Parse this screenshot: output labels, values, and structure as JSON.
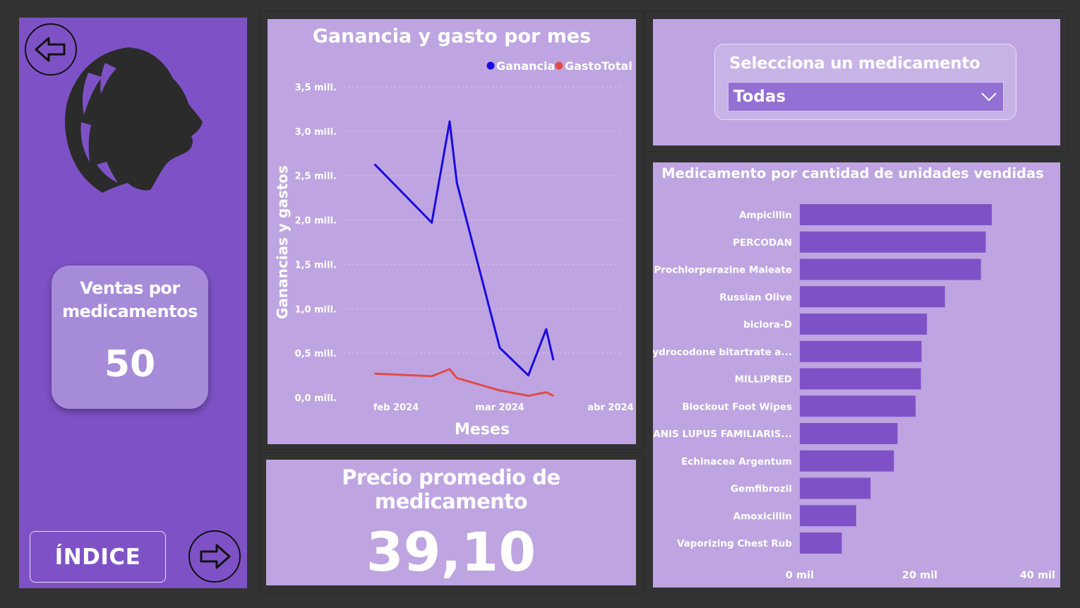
{
  "sidebar": {
    "kpi_label": "Ventas por medicamentos",
    "kpi_value": "50",
    "index_label": "ÍNDICE",
    "icons": {
      "back": "arrow-left-icon",
      "forward": "arrow-right-icon",
      "logo": "lion-logo-icon"
    }
  },
  "avg_price": {
    "title": "Precio promedio de medicamento",
    "value": "39,10"
  },
  "slicer": {
    "label": "Selecciona un medicamento",
    "selected": "Todas"
  },
  "colors": {
    "ganancia": "#1a0ae0",
    "gasto": "#e24a4a",
    "bar": "#7e52c6",
    "panel": "#bea5e1",
    "sidebar": "#7e52c6"
  },
  "chart_data": [
    {
      "type": "line",
      "title": "Ganancia y gasto por mes",
      "xlabel": "Meses",
      "ylabel": "Ganancias y gastos",
      "x_ticks": [
        "feb 2024",
        "mar 2024",
        "abr 2024"
      ],
      "y_ticks": [
        "0,0 mill.",
        "0,5 mill.",
        "1,0 mill.",
        "1,5 mill.",
        "2,0 mill.",
        "2,5 mill.",
        "3,0 mill.",
        "3,5 mill."
      ],
      "ylim": [
        0,
        3.5
      ],
      "legend_position": "top-right",
      "grid": true,
      "series": [
        {
          "name": "Ganancia",
          "points": [
            {
              "x": "2024-01-26",
              "y": 2.63
            },
            {
              "x": "2024-02-11",
              "y": 1.97
            },
            {
              "x": "2024-02-16",
              "y": 3.11
            },
            {
              "x": "2024-02-18",
              "y": 2.42
            },
            {
              "x": "2024-03-01",
              "y": 0.56
            },
            {
              "x": "2024-03-09",
              "y": 0.25
            },
            {
              "x": "2024-03-14",
              "y": 0.77
            },
            {
              "x": "2024-03-16",
              "y": 0.42
            }
          ]
        },
        {
          "name": "GastoTotal",
          "points": [
            {
              "x": "2024-01-26",
              "y": 0.27
            },
            {
              "x": "2024-02-11",
              "y": 0.24
            },
            {
              "x": "2024-02-16",
              "y": 0.32
            },
            {
              "x": "2024-02-18",
              "y": 0.22
            },
            {
              "x": "2024-03-01",
              "y": 0.08
            },
            {
              "x": "2024-03-09",
              "y": 0.02
            },
            {
              "x": "2024-03-14",
              "y": 0.06
            },
            {
              "x": "2024-03-16",
              "y": 0.02
            }
          ]
        }
      ]
    },
    {
      "type": "bar",
      "orientation": "horizontal",
      "title": "Medicamento por cantidad de unidades vendidas",
      "x_ticks": [
        "0 mil",
        "20 mil",
        "40 mil"
      ],
      "xlim": [
        0,
        40
      ],
      "grid": false,
      "categories": [
        "Ampicillin",
        "PERCODAN",
        "Prochlorperazine Maleate",
        "Russian Olive",
        "biclora-D",
        "hydrocodone bitartrate a...",
        "MILLIPRED",
        "Blockout Foot Wipes",
        "CANIS LUPUS FAMILIARIS...",
        "Echinacea Argentum",
        "Gemfibrozil",
        "Amoxicillin",
        "Vaporizing Chest Rub"
      ],
      "values": [
        32.0,
        31.0,
        30.2,
        24.2,
        21.2,
        20.3,
        20.2,
        19.3,
        16.3,
        15.7,
        11.8,
        9.4,
        7.0
      ]
    }
  ]
}
